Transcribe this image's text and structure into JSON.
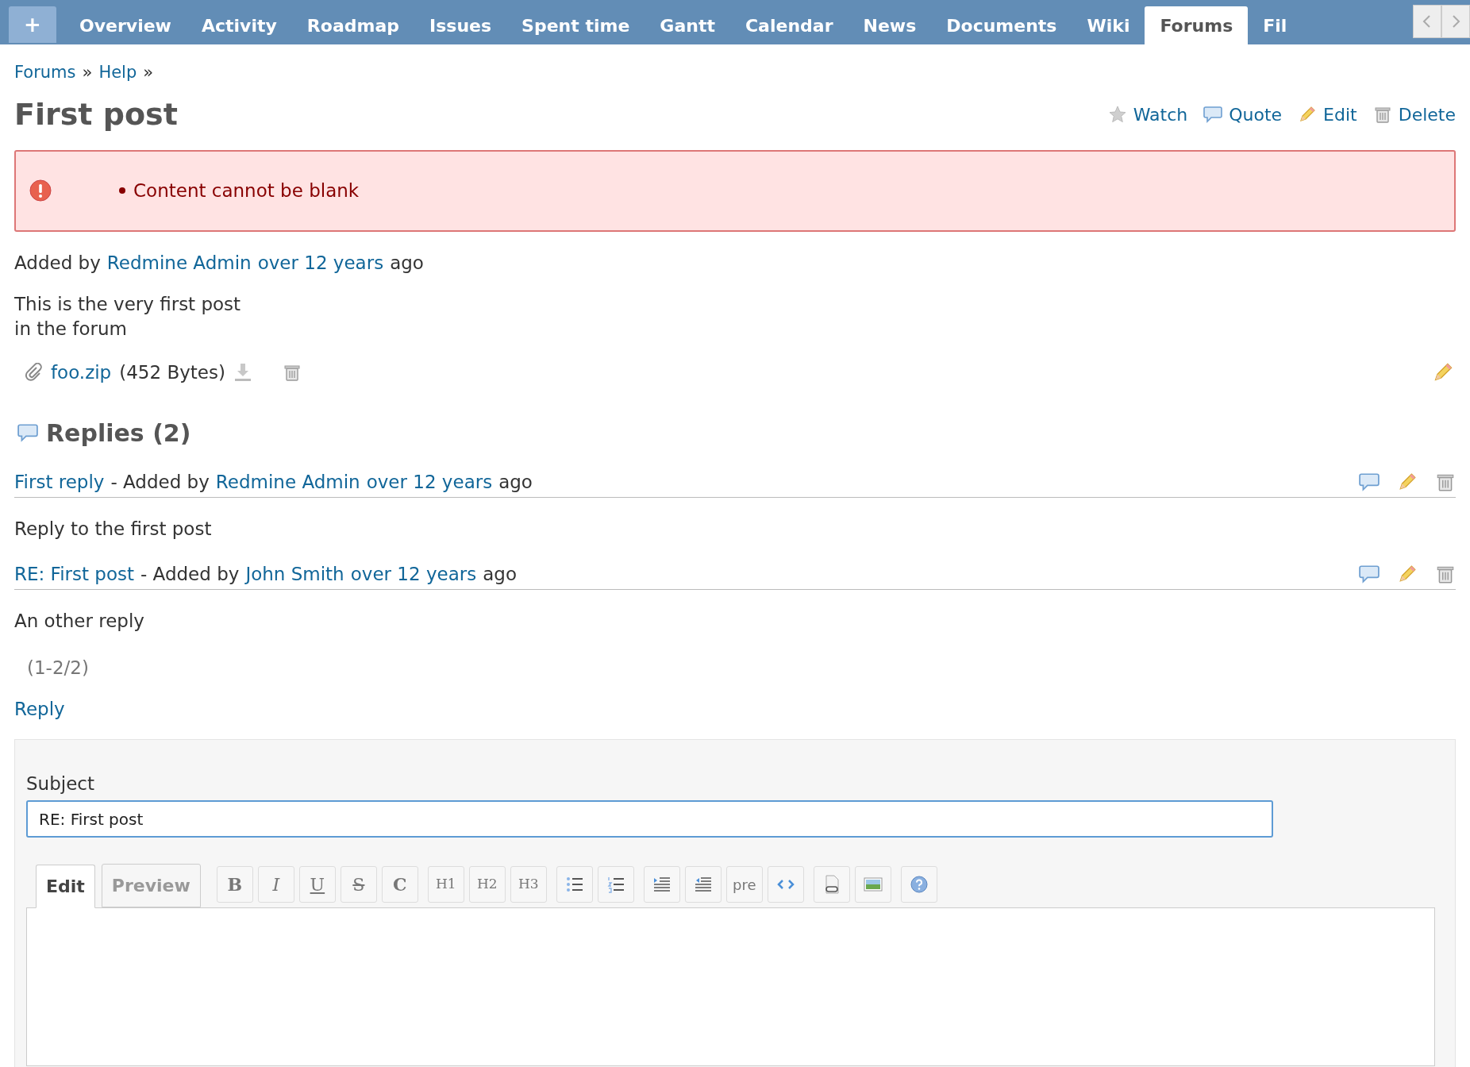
{
  "nav": {
    "new_button": "+",
    "tabs": [
      {
        "label": "Overview",
        "selected": false
      },
      {
        "label": "Activity",
        "selected": false
      },
      {
        "label": "Roadmap",
        "selected": false
      },
      {
        "label": "Issues",
        "selected": false
      },
      {
        "label": "Spent time",
        "selected": false
      },
      {
        "label": "Gantt",
        "selected": false
      },
      {
        "label": "Calendar",
        "selected": false
      },
      {
        "label": "News",
        "selected": false
      },
      {
        "label": "Documents",
        "selected": false
      },
      {
        "label": "Wiki",
        "selected": false
      },
      {
        "label": "Forums",
        "selected": true
      },
      {
        "label": "Fil",
        "selected": false
      }
    ]
  },
  "breadcrumb": [
    {
      "label": "Forums",
      "sep": "»"
    },
    {
      "label": "Help",
      "sep": "»"
    }
  ],
  "title": "First post",
  "actions": [
    {
      "kind": "watch",
      "label": "Watch"
    },
    {
      "kind": "quote",
      "label": "Quote"
    },
    {
      "kind": "edit",
      "label": "Edit"
    },
    {
      "kind": "delete",
      "label": "Delete"
    }
  ],
  "error": {
    "items": [
      "Content cannot be blank"
    ]
  },
  "post": {
    "prefix": "Added by",
    "author": "Redmine Admin",
    "age": "over 12 years",
    "suffix": "ago",
    "body": [
      "This is the very first post",
      "in the forum"
    ],
    "attachment": {
      "name": "foo.zip",
      "size": "(452 Bytes)"
    }
  },
  "replies": {
    "heading": "Replies (2)",
    "items": [
      {
        "subject": "First reply",
        "sep": "- Added by",
        "author": "Redmine Admin",
        "age": "over 12 years",
        "suffix": "ago",
        "body": "Reply to the first post"
      },
      {
        "subject": "RE: First post",
        "sep": "- Added by",
        "author": "John Smith",
        "age": "over 12 years",
        "suffix": "ago",
        "body": "An other reply"
      }
    ],
    "pagination": "(1-2/2)"
  },
  "reply_link": "Reply",
  "form": {
    "subject_label": "Subject",
    "subject_value": "RE: First post",
    "tabs": [
      {
        "label": "Edit",
        "selected": true
      },
      {
        "label": "Preview",
        "selected": false
      }
    ],
    "toolbar": [
      [
        {
          "kind": "bold",
          "label": "B"
        },
        {
          "kind": "italic",
          "label": "I"
        },
        {
          "kind": "underline",
          "label": "U"
        },
        {
          "kind": "strike",
          "label": "S"
        },
        {
          "kind": "code",
          "label": "C"
        }
      ],
      [
        {
          "kind": "heading",
          "label": "H1"
        },
        {
          "kind": "heading",
          "label": "H2"
        },
        {
          "kind": "heading",
          "label": "H3"
        }
      ],
      [
        {
          "kind": "ul"
        },
        {
          "kind": "ol"
        }
      ],
      [
        {
          "kind": "indent"
        },
        {
          "kind": "outdent"
        },
        {
          "kind": "pre",
          "label": "pre"
        },
        {
          "kind": "codeblock"
        }
      ],
      [
        {
          "kind": "link"
        },
        {
          "kind": "image"
        }
      ],
      [
        {
          "kind": "help"
        }
      ]
    ]
  }
}
